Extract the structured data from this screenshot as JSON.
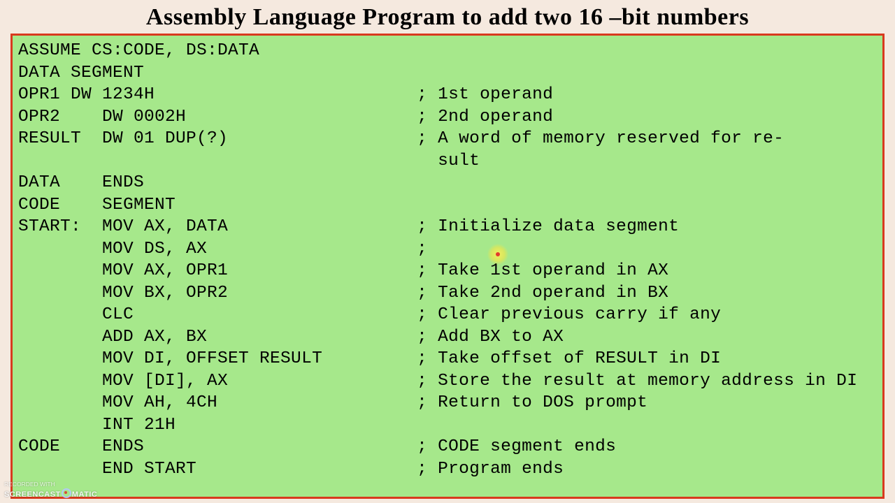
{
  "title": "Assembly Language Program to add two 16 –bit numbers",
  "code_lines": [
    "ASSUME CS:CODE, DS:DATA",
    "DATA SEGMENT",
    "OPR1 DW 1234H                         ; 1st operand",
    "OPR2    DW 0002H                      ; 2nd operand",
    "RESULT  DW 01 DUP(?)                  ; A word of memory reserved for re-",
    "                                        sult",
    "DATA    ENDS",
    "CODE    SEGMENT",
    "START:  MOV AX, DATA                  ; Initialize data segment",
    "        MOV DS, AX                    ;",
    "        MOV AX, OPR1                  ; Take 1st operand in AX",
    "        MOV BX, OPR2                  ; Take 2nd operand in BX",
    "        CLC                           ; Clear previous carry if any",
    "        ADD AX, BX                    ; Add BX to AX",
    "        MOV DI, OFFSET RESULT         ; Take offset of RESULT in DI",
    "        MOV [DI], AX                  ; Store the result at memory address in DI",
    "        MOV AH, 4CH                   ; Return to DOS prompt",
    "        INT 21H",
    "CODE    ENDS                          ; CODE segment ends",
    "        END START                     ; Program ends"
  ],
  "watermark": {
    "line1": "RECORDED WITH",
    "line2_a": "SCREENCAST",
    "line2_b": "MATIC"
  }
}
